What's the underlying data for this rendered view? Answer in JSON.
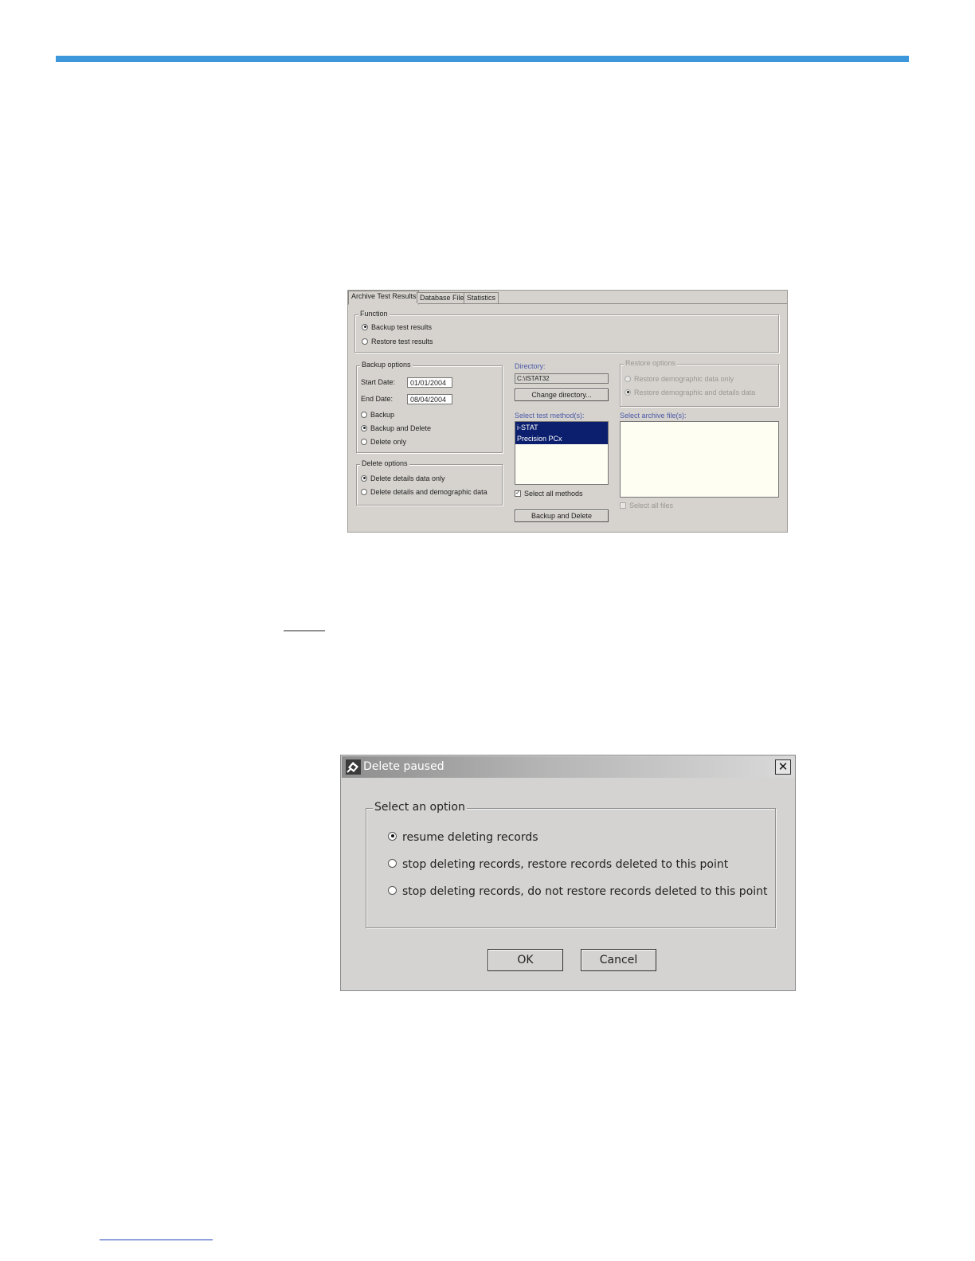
{
  "archive": {
    "tabs": [
      "Archive Test Results",
      "Database File",
      "Statistics"
    ],
    "function": {
      "legend": "Function",
      "options": [
        {
          "label": "Backup test results",
          "selected": true
        },
        {
          "label": "Restore test results",
          "selected": false
        }
      ]
    },
    "backup_options": {
      "legend": "Backup options",
      "start_label": "Start Date:",
      "start_value": "01/01/2004",
      "end_label": "End Date:",
      "end_value": "08/04/2004",
      "options": [
        {
          "label": "Backup",
          "selected": false
        },
        {
          "label": "Backup and Delete",
          "selected": true
        },
        {
          "label": "Delete only",
          "selected": false
        }
      ]
    },
    "delete_options": {
      "legend": "Delete options",
      "options": [
        {
          "label": "Delete details data only",
          "selected": true
        },
        {
          "label": "Delete details and demographic data",
          "selected": false
        }
      ]
    },
    "directory": {
      "label": "Directory:",
      "value": "C:\\ISTAT32",
      "change_button": "Change directory..."
    },
    "test_methods": {
      "label": "Select test method(s):",
      "items": [
        "i-STAT",
        "Precision PCx"
      ],
      "select_all_label": "Select all methods",
      "select_all_checked": true
    },
    "action_button": "Backup and Delete",
    "restore_options": {
      "legend": "Restore options",
      "options": [
        {
          "label": "Restore demographic data only",
          "selected": false
        },
        {
          "label": "Restore demographic and details data",
          "selected": true
        }
      ]
    },
    "archive_files": {
      "label": "Select archive file(s):",
      "select_all_label": "Select all files",
      "select_all_checked": false
    }
  },
  "dialog": {
    "title": "Delete paused",
    "close_symbol": "✕",
    "legend": "Select an option",
    "options": [
      {
        "label": "resume deleting records",
        "selected": true
      },
      {
        "label": "stop deleting records, restore records deleted to this point",
        "selected": false
      },
      {
        "label": "stop deleting records, do not restore records deleted to this point",
        "selected": false
      }
    ],
    "ok_label": "OK",
    "cancel_label": "Cancel"
  },
  "colors": {
    "accent_rule": "#3d97db",
    "selection": "#0b1f6e"
  }
}
